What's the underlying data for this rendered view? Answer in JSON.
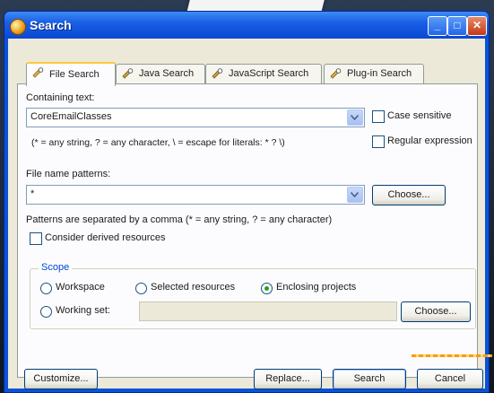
{
  "window": {
    "title": "Search"
  },
  "titlebar_buttons": {
    "minimize": "_",
    "maximize": "□",
    "close": "✕"
  },
  "tabs": [
    {
      "label": "File Search",
      "icon": "file-search-icon",
      "active": true
    },
    {
      "label": "Java Search",
      "icon": "java-search-icon",
      "active": false
    },
    {
      "label": "JavaScript Search",
      "icon": "javascript-search-icon",
      "active": false
    },
    {
      "label": "Plug-in Search",
      "icon": "plugin-search-icon",
      "active": false
    }
  ],
  "file_search": {
    "containing_text_label": "Containing text:",
    "containing_text_value": "CoreEmailClasses",
    "case_sensitive_label": "Case sensitive",
    "regex_label": "Regular expression",
    "hint_text": "(* = any string, ? = any character, \\ = escape for literals: * ? \\)",
    "file_patterns_label": "File name patterns:",
    "file_patterns_value": "*",
    "choose_label": "Choose...",
    "patterns_hint": "Patterns are separated by a comma (* = any string, ? = any character)",
    "derived_label": "Consider derived resources"
  },
  "scope": {
    "title": "Scope",
    "workspace": "Workspace",
    "selected_resources": "Selected resources",
    "enclosing_projects": "Enclosing projects",
    "working_set": "Working set:",
    "choose_label": "Choose...",
    "selected": "enclosing_projects"
  },
  "footer": {
    "customize": "Customize...",
    "replace": "Replace...",
    "search": "Search",
    "cancel": "Cancel"
  },
  "colors": {
    "titlebar": "#0a48d2",
    "dialog": "#ece9d8",
    "group_title": "#0046d5",
    "selection": "#21a121"
  }
}
